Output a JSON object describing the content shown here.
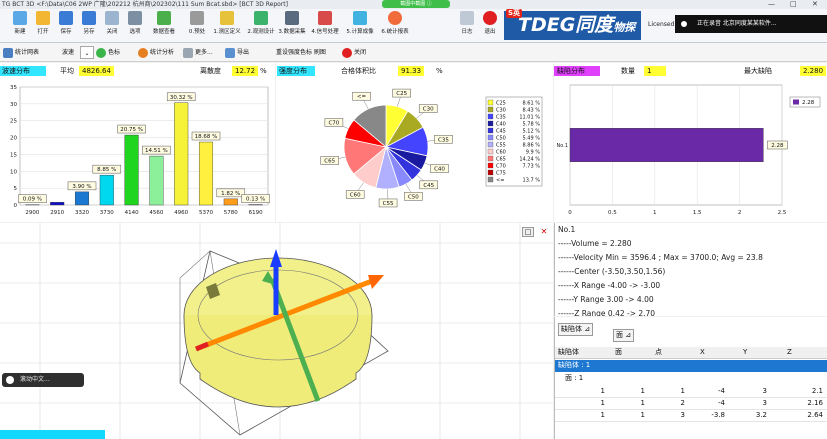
{
  "titlebar": {
    "text": "TG BCT 3D <F:\\Data\\C06 2WP 广隆\\202212 杭州商\\202302\\111 Sum Bcat.sbd> [BCT 3D Report]",
    "pill": "截图中截图 ⓘ",
    "min": "—",
    "max": "□",
    "close": "✕"
  },
  "ribbon": {
    "items": [
      "新建",
      "打开",
      "保存",
      "另存",
      "关闭",
      "选项",
      "数据查看",
      "0.预处",
      "1.测区定义",
      "2.观测设计",
      "3.数据采集",
      "4.信号处理",
      "5.计算成像",
      "6.统计报表",
      "日志",
      "退出"
    ],
    "logo": "TDEG同度",
    "logo_sub": "物探",
    "logo_badge": "S英",
    "licensed": "Licensed",
    "notify": "正在录音 北京同度某某软件..."
  },
  "toolbar2": {
    "items": [
      "统计网表",
      "波速",
      "色标",
      "统计分析",
      "更多...",
      "导出",
      "重设强度色标 刷图",
      "关闭"
    ],
    "select_value": ""
  },
  "wave": {
    "label": "波速分布",
    "avg_label": "平均",
    "avg": "4826.64",
    "disc_label": "离散度",
    "disc": "12.72",
    "pct": "%"
  },
  "strength": {
    "label": "强度分布",
    "ratio_label": "合格体积比",
    "ratio": "91.33",
    "pct": "%"
  },
  "defect": {
    "label": "缺陷分布",
    "count_label": "数量",
    "count": "1",
    "max_label": "最大缺陷",
    "max": "2.280"
  },
  "chart_data": [
    {
      "type": "bar",
      "categories": [
        "2900",
        "2910",
        "3320",
        "3730",
        "4140",
        "4560",
        "4960",
        "5370",
        "5780",
        "6190"
      ],
      "values": [
        0.09,
        0.8,
        3.9,
        8.85,
        20.75,
        14.51,
        30.32,
        18.68,
        1.82,
        0.13
      ],
      "data_labels": [
        "0.09 %",
        "",
        "3.90 %",
        "8.85 %",
        "20.75 %",
        "14.51 %",
        "30.32 %",
        "18.68 %",
        "1.82 %",
        "0.13 %"
      ],
      "colors": [
        "#0b0b90",
        "#1010c8",
        "#1a78d0",
        "#00d8f0",
        "#1fd51f",
        "#8cf09a",
        "#f6f23a",
        "#fff040",
        "#ff9d1a",
        "#ff2a1a"
      ],
      "yticks": [
        "0",
        "5",
        "10",
        "15",
        "20",
        "25",
        "30",
        "35"
      ],
      "ylim": [
        0,
        35
      ]
    },
    {
      "type": "pie",
      "categories": [
        "C25",
        "C30",
        "C35",
        "C40",
        "C45",
        "C50",
        "C55",
        "C60",
        "C65",
        "C70",
        "C75",
        "<="
      ],
      "values": [
        8.61,
        8.43,
        11.01,
        5.78,
        5.12,
        5.49,
        8.86,
        9.9,
        14.24,
        7.73,
        0,
        13.7
      ],
      "legend_values": [
        "8.61 %",
        "8.43 %",
        "11.01 %",
        "5.78 %",
        "5.12 %",
        "5.49 %",
        "8.86 %",
        "9.9 %",
        "14.24 %",
        "7.73 %",
        "",
        "13.7 %"
      ],
      "colors": [
        "#ffff33",
        "#aaaa22",
        "#4444ff",
        "#1a1aa0",
        "#3333dd",
        "#8888ff",
        "#b0b0ff",
        "#ffcccc",
        "#ff7777",
        "#ff0000",
        "#bb0000",
        "#888888"
      ]
    },
    {
      "type": "bar",
      "orientation": "horizontal",
      "categories": [
        "No.1"
      ],
      "values": [
        2.28
      ],
      "data_labels": [
        "2.28"
      ],
      "legend": "2.28",
      "xticks": [
        "0",
        "0.5",
        "1",
        "1.5",
        "2",
        "2.5"
      ],
      "xlim": [
        0,
        2.5
      ],
      "colors": [
        "#6a2aa8"
      ]
    }
  ],
  "view3d": {
    "hint": "滚动中文..."
  },
  "info": {
    "lines": [
      "No.1",
      "-----Volume = 2.280",
      "------Velocity Min = 3596.4 ; Max = 3700.0; Avg = 23.8",
      "------Center (-3.50,3.50,1.56)",
      "------X Range -4.00 -> -3.00",
      "------Y Range 3.00 -> 4.00",
      "------Z Range 0.42 -> 2.70"
    ]
  },
  "tree": {
    "tabs": [
      "缺陷体",
      "面"
    ],
    "columns": [
      "缺陷体",
      "面",
      "点",
      "X",
      "Y",
      "Z"
    ],
    "group": "缺陷体 : 1",
    "sub": "面 : 1",
    "rows": [
      [
        "1",
        "1",
        "1",
        "-4",
        "3",
        "2.1"
      ],
      [
        "1",
        "1",
        "2",
        "-4",
        "3",
        "2.16"
      ],
      [
        "1",
        "1",
        "3",
        "-3.8",
        "3.2",
        "2.64"
      ]
    ]
  }
}
